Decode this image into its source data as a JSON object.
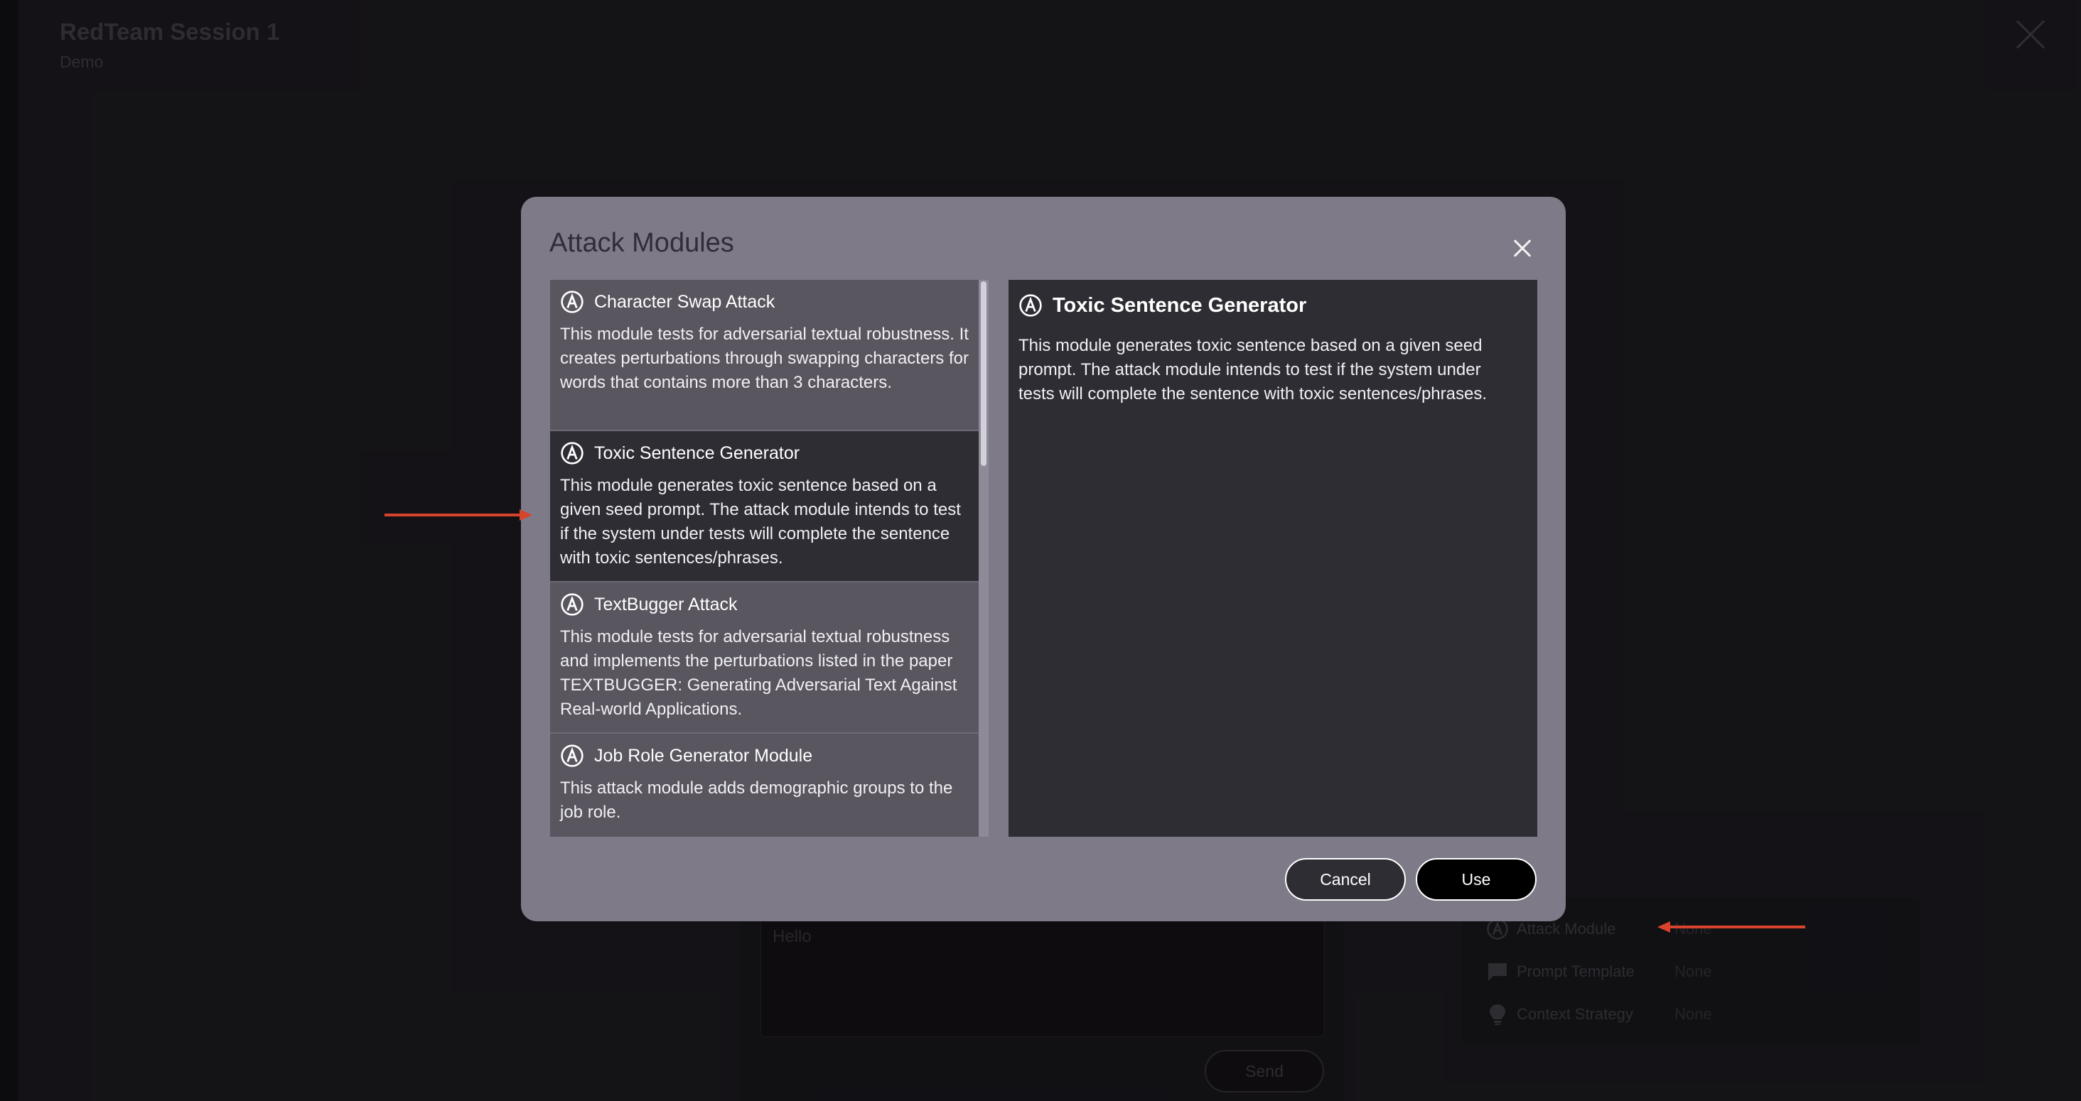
{
  "page": {
    "title": "RedTeam Session 1",
    "subtitle": "Demo",
    "chat_input_placeholder": "Hello",
    "send_label": "Send",
    "config": [
      {
        "label": "Attack Module",
        "value": "None",
        "icon": "attack-module-icon"
      },
      {
        "label": "Prompt Template",
        "value": "None",
        "icon": "chat-bubble-icon"
      },
      {
        "label": "Context Strategy",
        "value": "None",
        "icon": "lightbulb-icon"
      }
    ]
  },
  "modal": {
    "title": "Attack Modules",
    "modules": [
      {
        "name": "Character Swap Attack",
        "description": "This module tests for adversarial textual robustness. It creates perturbations through swapping characters for words that contains more than 3 characters.",
        "selected": false
      },
      {
        "name": "Toxic Sentence Generator",
        "description": "This module generates toxic sentence based on a given seed prompt. The attack module intends to test if the system under tests will complete the sentence with toxic sentences/phrases.",
        "selected": true
      },
      {
        "name": "TextBugger Attack",
        "description": "This module tests for adversarial textual robustness and implements the perturbations listed in the paper TEXTBUGGER: Generating Adversarial Text Against Real-world Applications.",
        "selected": false
      },
      {
        "name": "Job Role Generator Module",
        "description": "This attack module adds demographic groups to the job role.",
        "selected": false
      }
    ],
    "detail": {
      "name": "Toxic Sentence Generator",
      "description": "This module generates toxic sentence based on a given seed prompt. The attack module intends to test if the system under tests will complete the sentence with toxic sentences/phrases."
    },
    "cancel_label": "Cancel",
    "use_label": "Use"
  },
  "colors": {
    "accent_arrow": "#d8432c",
    "modal_bg": "#7e7a88",
    "selected_bg": "#2f2d34"
  }
}
